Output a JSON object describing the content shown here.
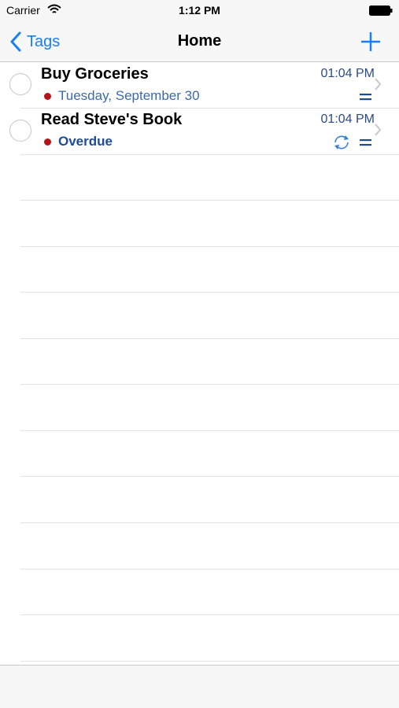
{
  "status_bar": {
    "carrier": "Carrier",
    "time": "1:12 PM"
  },
  "nav": {
    "back_label": "Tags",
    "title": "Home"
  },
  "tasks": [
    {
      "title": "Buy Groceries",
      "time": "01:04 PM",
      "subtitle": "Tuesday, September 30",
      "has_note": true,
      "repeats": false
    },
    {
      "title": "Read Steve's Book",
      "time": "01:04 PM",
      "subtitle": "Overdue",
      "has_note": true,
      "repeats": true
    }
  ],
  "icons": {
    "back": "chevron-left-icon",
    "add": "plus-icon",
    "complete": "circle-checkbox-icon",
    "disclosure": "chevron-right-icon",
    "note": "note-lines-icon",
    "repeat": "repeat-icon",
    "wifi": "wifi-icon",
    "battery": "battery-icon"
  },
  "colors": {
    "accent": "#1a7ef7",
    "time_text": "#2b4b86",
    "subtitle_text": "#3b6aa8",
    "due_dot": "#b0151c",
    "bar_background": "#f7f7f7"
  }
}
